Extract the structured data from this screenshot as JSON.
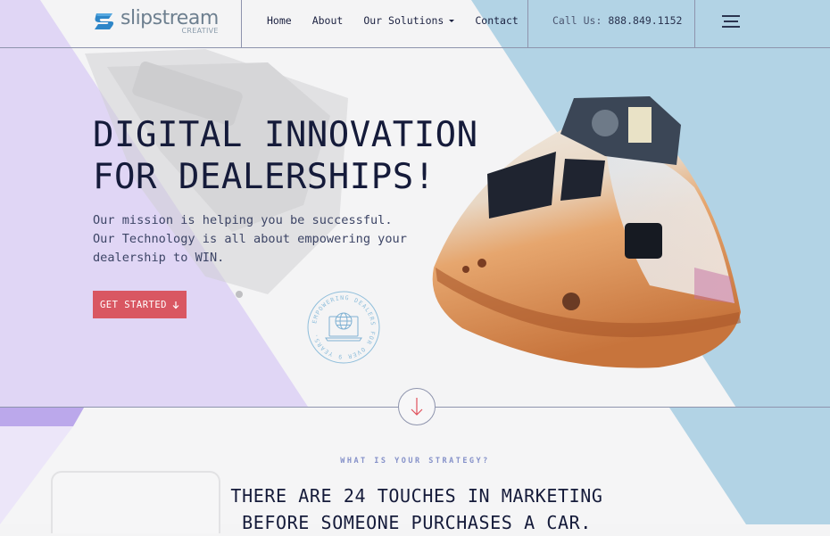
{
  "brand": {
    "name": "slipstream",
    "subtitle": "CREATIVE",
    "colors": {
      "lavender": "#e0d6f5",
      "lavender_dark": "#bba8eb",
      "sky": "#b2d3e5",
      "navy": "#151b3a",
      "accent_red": "#d95762",
      "eyebrow_blue": "#8591c9"
    }
  },
  "nav": {
    "items": [
      {
        "label": "Home"
      },
      {
        "label": "About"
      },
      {
        "label": "Our Solutions",
        "has_dropdown": true
      },
      {
        "label": "Contact"
      }
    ],
    "phone_label": "Call Us:",
    "phone_number": "888.849.1152",
    "menu_icon": "hamburger-icon"
  },
  "hero": {
    "title_lines": [
      "DIGITAL INNOVATION",
      "FOR DEALERSHIPS!"
    ],
    "text_lines": [
      "Our mission is helping you be successful.",
      "Our Technology is all about empowering your",
      "dealership to WIN."
    ],
    "cta_label": "GET STARTED",
    "cta_icon": "arrow-down-icon",
    "badge_text": "EMPOWERING DEALERS FOR OVER 9 YEARS.",
    "badge_icon": "laptop-globe-icon",
    "image": "space-capsule"
  },
  "scroll_icon": "arrow-down-icon",
  "strategy": {
    "eyebrow": "WHAT IS YOUR STRATEGY?",
    "title_lines": [
      "THERE ARE 24 TOUCHES IN MARKETING",
      "BEFORE SOMEONE PURCHASES A CAR."
    ]
  }
}
